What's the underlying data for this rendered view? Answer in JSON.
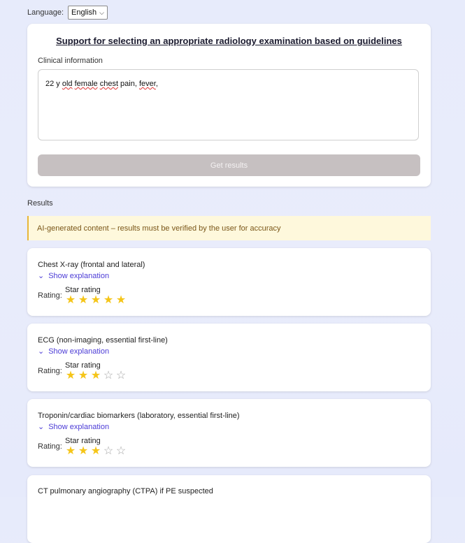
{
  "language": {
    "label": "Language:",
    "selected": "English"
  },
  "form": {
    "title": "Support for selecting an appropriate radiology examination based on guidelines",
    "clinical_label": "Clinical information",
    "clinical_text_parts": [
      "22 y ",
      "old",
      " ",
      "female",
      " ",
      "chest",
      " pain, ",
      "fever",
      ","
    ],
    "button_label": "Get results"
  },
  "results": {
    "heading": "Results",
    "warning": "AI-generated content – results must be verified by the user for accuracy",
    "items": [
      {
        "name": "Chest X-ray (frontal and lateral)",
        "show_explanation": "Show explanation",
        "rating_label": "Rating:",
        "star_label": "Star rating",
        "stars": 5
      },
      {
        "name": "ECG (non-imaging, essential first-line)",
        "show_explanation": "Show explanation",
        "rating_label": "Rating:",
        "star_label": "Star rating",
        "stars": 3
      },
      {
        "name": "Troponin/cardiac biomarkers (laboratory, essential first-line)",
        "show_explanation": "Show explanation",
        "rating_label": "Rating:",
        "star_label": "Star rating",
        "stars": 3
      },
      {
        "name": "CT pulmonary angiography (CTPA) if PE suspected"
      }
    ],
    "max_stars": 5
  },
  "colors": {
    "star_full": "#f5c518",
    "link": "#4b3bd6",
    "button_disabled": "#c6c0c1",
    "warning_bg": "#fef8dc"
  }
}
